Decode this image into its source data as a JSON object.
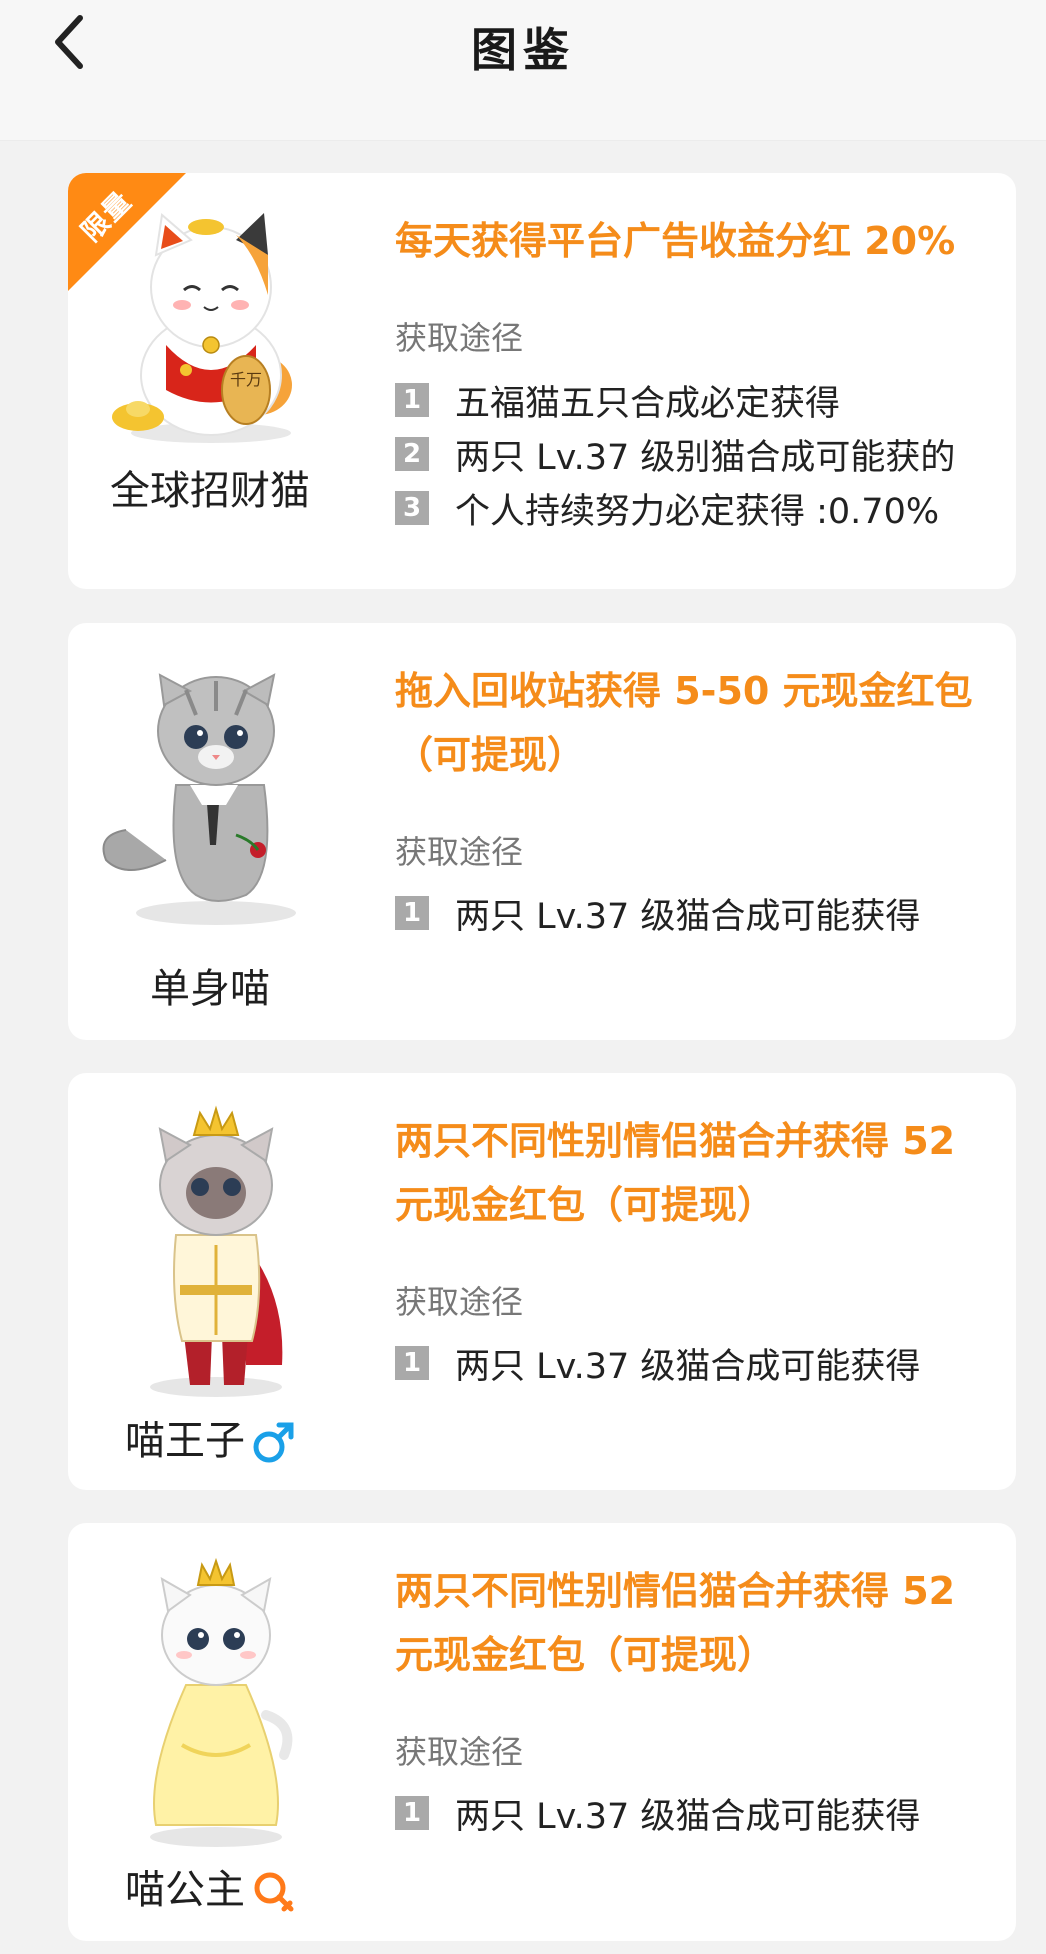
{
  "header": {
    "title": "图鉴"
  },
  "cards": [
    {
      "badge": "限量",
      "cat_name": "全球招财猫",
      "benefit_lines": [
        "每天获得平台广告收益分红 20%"
      ],
      "method_label": "获取途径",
      "methods": [
        {
          "num": "1",
          "text": "五福猫五只合成必定获得"
        },
        {
          "num": "2",
          "text": "两只 Lv.37 级别猫合成可能获的"
        },
        {
          "num": "3",
          "text": "个人持续努力必定获得 :0.70%"
        }
      ]
    },
    {
      "cat_name": "单身喵",
      "benefit_lines": [
        "拖入回收站获得 5-50 元现金红包",
        "（可提现）"
      ],
      "method_label": "获取途径",
      "methods": [
        {
          "num": "1",
          "text": "两只 Lv.37 级猫合成可能获得"
        }
      ]
    },
    {
      "cat_name": "喵王子",
      "gender": "male",
      "gender_color": "#1aa0e8",
      "benefit_lines": [
        "两只不同性别情侣猫合并获得 52",
        "元现金红包（可提现）"
      ],
      "method_label": "获取途径",
      "methods": [
        {
          "num": "1",
          "text": "两只 Lv.37 级猫合成可能获得"
        }
      ]
    },
    {
      "cat_name": "喵公主",
      "gender": "female",
      "gender_color": "#ff7a1a",
      "benefit_lines": [
        "两只不同性别情侣猫合并获得 52",
        "元现金红包（可提现）"
      ],
      "method_label": "获取途径",
      "methods": [
        {
          "num": "1",
          "text": "两只 Lv.37 级猫合成可能获得"
        }
      ]
    }
  ],
  "colors": {
    "accent": "#f58c1a",
    "ribbon": "#ff8a14",
    "background": "#f2f2f2"
  }
}
